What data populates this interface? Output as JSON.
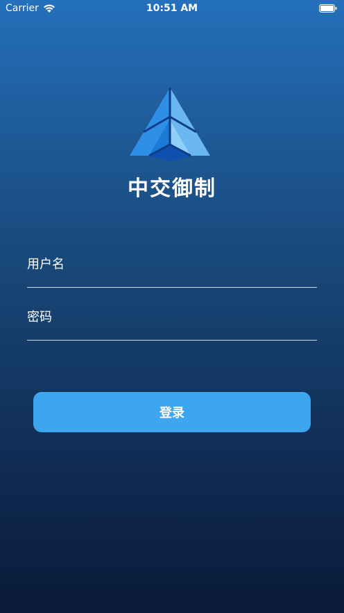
{
  "status_bar": {
    "carrier": "Carrier",
    "time": "10:51 AM"
  },
  "app": {
    "name": "中交御制"
  },
  "form": {
    "username_placeholder": "用户名",
    "password_placeholder": "密码",
    "login_label": "登录"
  },
  "colors": {
    "background_top": "#2470bb",
    "background_bottom": "#0a1a38",
    "button": "#3ea6ee",
    "logo_light": "#7dc6f7",
    "logo_mid": "#2f8fe6",
    "logo_dark": "#0e4fb0"
  },
  "icons": [
    "wifi-icon",
    "battery-icon",
    "app-logo"
  ]
}
